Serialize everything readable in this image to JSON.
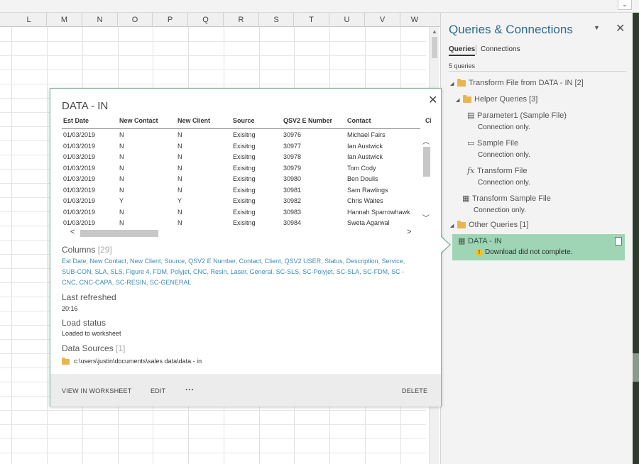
{
  "sheet": {
    "columns": [
      "L",
      "M",
      "N",
      "O",
      "P",
      "Q",
      "R",
      "S",
      "T",
      "U",
      "V",
      "W"
    ]
  },
  "pane": {
    "title": "Queries & Connections",
    "tabs": [
      "Queries",
      "Connections"
    ],
    "query_count": "5 queries",
    "tree": [
      {
        "label": "Transform File from DATA - IN [2]"
      },
      {
        "label": "Helper Queries [3]"
      },
      {
        "label": "Parameter1 (Sample File)",
        "sub": "Connection only."
      },
      {
        "label": "Sample File",
        "sub": "Connection only."
      },
      {
        "label": "Transform File",
        "sub": "Connection only."
      },
      {
        "label": "Transform Sample File",
        "sub": "Connection only."
      },
      {
        "label": "Other Queries [1]"
      }
    ],
    "selected": {
      "name": "DATA - IN",
      "warning": "Download did not complete."
    }
  },
  "card": {
    "title": "DATA - IN",
    "headers": [
      "Est Date",
      "New Contact",
      "New Client",
      "Source",
      "QSV2 E Number",
      "Contact",
      "Cl"
    ],
    "rows": [
      [
        "01/03/2019",
        "N",
        "N",
        "Exisitng",
        "30976",
        "Michael Fairs"
      ],
      [
        "01/03/2019",
        "N",
        "N",
        "Exisitng",
        "30977",
        "Ian Austwick"
      ],
      [
        "01/03/2019",
        "N",
        "N",
        "Exisitng",
        "30978",
        "Ian Austwick"
      ],
      [
        "01/03/2019",
        "N",
        "N",
        "Exisitng",
        "30979",
        "Tom Cody"
      ],
      [
        "01/03/2019",
        "N",
        "N",
        "Exisitng",
        "30980",
        "Ben Doulis"
      ],
      [
        "01/03/2019",
        "N",
        "N",
        "Exisitng",
        "30981",
        "Sam Rawlings"
      ],
      [
        "01/03/2019",
        "Y",
        "Y",
        "Exisitng",
        "30982",
        "Chris Waites"
      ],
      [
        "01/03/2019",
        "N",
        "N",
        "Exisitng",
        "30983",
        "Hannah Sparrowhawk"
      ],
      [
        "01/03/2019",
        "N",
        "N",
        "Exisitng",
        "30984",
        "Sweta Agarwal"
      ]
    ],
    "columns_label": "Columns",
    "columns_count": "[29]",
    "columns_list": "Est Date, New Contact, New Client, Source, QSV2 E Number, Contact, Client, QSV2 USER, Status, Description, Service, SUB-CON, SLA, SLS, Figure 4, FDM, Polyjet, CNC, Resin, Laser, General, SC-SLS, SC-Polyjet, SC-SLA, SC-FDM, SC -CNC, CNC-CAPA, SC-RESIN, SC-GENERAL",
    "last_refreshed_label": "Last refreshed",
    "last_refreshed": "20:16",
    "load_status_label": "Load status",
    "load_status": "Loaded to worksheet",
    "data_sources_label": "Data Sources",
    "data_sources_count": "[1]",
    "data_source_path": "c:\\users\\justin\\documents\\sales data\\data - in",
    "footer": {
      "view": "VIEW IN WORKSHEET",
      "edit": "EDIT",
      "more": "···",
      "delete": "DELETE"
    }
  }
}
